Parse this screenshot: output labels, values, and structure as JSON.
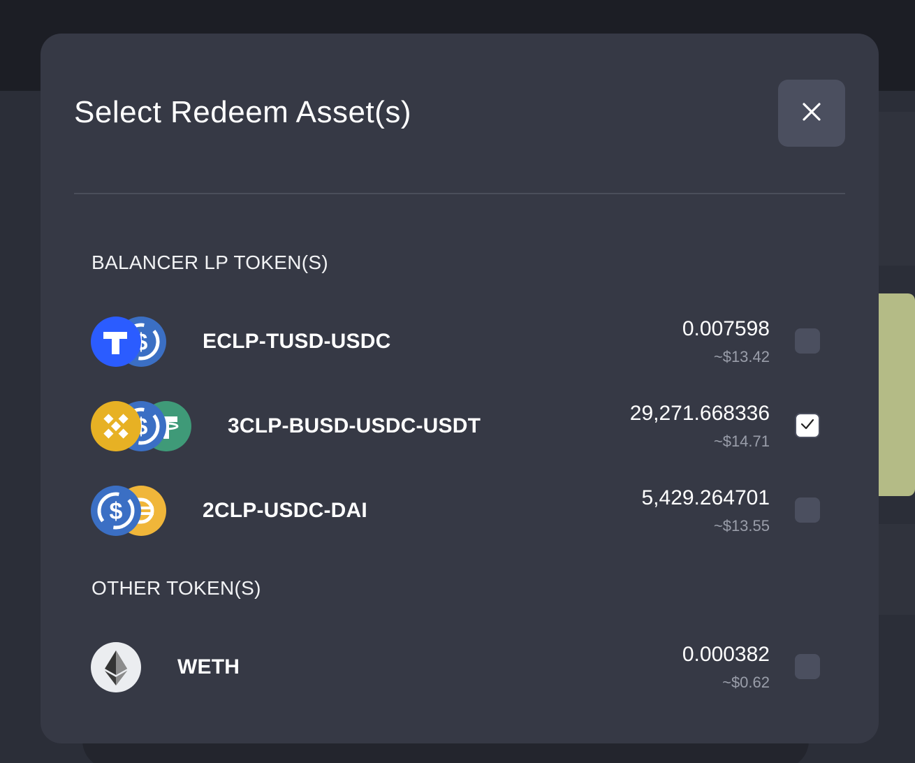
{
  "modal": {
    "title": "Select Redeem Asset(s)"
  },
  "sections": {
    "lp_label": "BALANCER LP TOKEN(S)",
    "other_label": "OTHER TOKEN(S)"
  },
  "lp_tokens": [
    {
      "name": "ECLP-TUSD-USDC",
      "amount": "0.007598",
      "usd": "~$13.42",
      "checked": false,
      "icons": [
        "tusd-icon",
        "usdc-icon"
      ]
    },
    {
      "name": "3CLP-BUSD-USDC-USDT",
      "amount": "29,271.668336",
      "usd": "~$14.71",
      "checked": true,
      "icons": [
        "busd-icon",
        "usdc-icon",
        "usdt-icon"
      ]
    },
    {
      "name": "2CLP-USDC-DAI",
      "amount": "5,429.264701",
      "usd": "~$13.55",
      "checked": false,
      "icons": [
        "usdc-icon",
        "dai-icon"
      ]
    }
  ],
  "other_tokens": [
    {
      "name": "WETH",
      "amount": "0.000382",
      "usd": "~$0.62",
      "checked": false,
      "icons": [
        "eth-icon"
      ]
    }
  ],
  "colors": {
    "modal_bg": "#363945",
    "tusd": "#2b5cff",
    "usdc": "#3b6fc4",
    "busd": "#e7b124",
    "usdt": "#3f9a78",
    "dai": "#f0b63a"
  }
}
